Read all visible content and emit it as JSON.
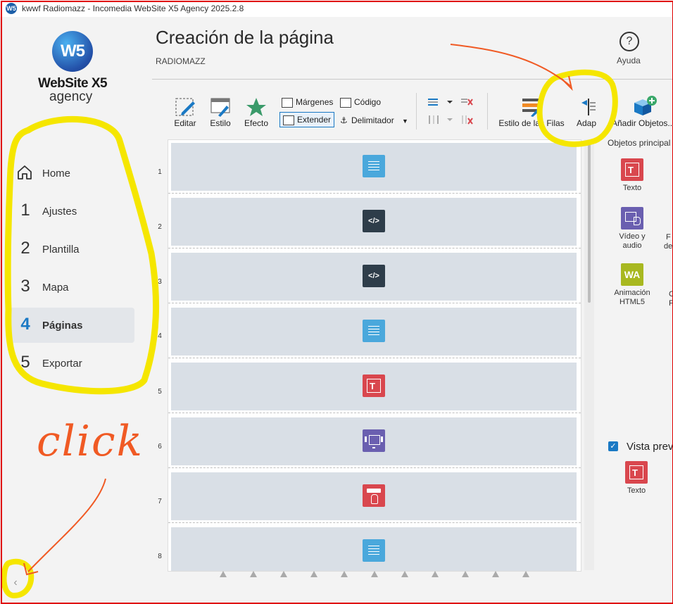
{
  "window": {
    "title": "kwwf Radiomazz - Incomedia WebSite X5 Agency 2025.2.8",
    "app_icon": "W5"
  },
  "logo": {
    "mark": "W5",
    "name": "WebSite X5",
    "edition": "agency"
  },
  "nav": [
    {
      "num": "",
      "label": "Home",
      "icon": "home-icon"
    },
    {
      "num": "1",
      "label": "Ajustes"
    },
    {
      "num": "2",
      "label": "Plantilla"
    },
    {
      "num": "3",
      "label": "Mapa"
    },
    {
      "num": "4",
      "label": "Páginas",
      "active": true
    },
    {
      "num": "5",
      "label": "Exportar"
    }
  ],
  "collapse": {
    "label": "‹"
  },
  "header": {
    "title": "Creación de la página",
    "subtitle": "RADIOMAZZ",
    "help_label": "Ayuda",
    "help_glyph": "?"
  },
  "toolbar": {
    "editar": "Editar",
    "estilo": "Estilo",
    "efecto": "Efecto",
    "margenes": "Márgenes",
    "extender": "Extender",
    "codigo": "Código",
    "delimitador": "Delimitador",
    "estilo_filas": "Estilo de las Filas",
    "adaptar": "Adap",
    "anadir_objetos": "Añadir Objetos..."
  },
  "rows": [
    {
      "num": "1",
      "object": "menu"
    },
    {
      "num": "2",
      "object": "code",
      "glyph": "</>"
    },
    {
      "num": "3",
      "object": "code",
      "glyph": "</>"
    },
    {
      "num": "4",
      "object": "menu"
    },
    {
      "num": "5",
      "object": "text",
      "glyph": "T"
    },
    {
      "num": "6",
      "object": "gallery"
    },
    {
      "num": "7",
      "object": "button"
    },
    {
      "num": "8",
      "object": "menu"
    }
  ],
  "objects_panel": {
    "title": "Objetos principal",
    "items": [
      {
        "label": "Texto",
        "glyph": "T"
      },
      {
        "label": "Vídeo y audio"
      },
      {
        "label": "Animación HTML5",
        "glyph": "WA"
      }
    ],
    "cut_labels": [
      "F",
      "de",
      "C",
      "F"
    ]
  },
  "preview": {
    "label": "Vista prev",
    "checked": true,
    "item_label": "Texto",
    "item_glyph": "T"
  },
  "annotations": {
    "click_text": "click",
    "highlight_color": "#f5e600",
    "arrow_color": "#f05a24",
    "frame_color": "#e00000"
  },
  "colors": {
    "accent": "#1a79c4",
    "row_bg": "#d9dfe6",
    "text_obj": "#d9474e",
    "menu_obj": "#4aa8dc",
    "code_obj": "#2e3d4a",
    "gallery_obj": "#6a5fb0",
    "anim_obj": "#a8b820"
  }
}
